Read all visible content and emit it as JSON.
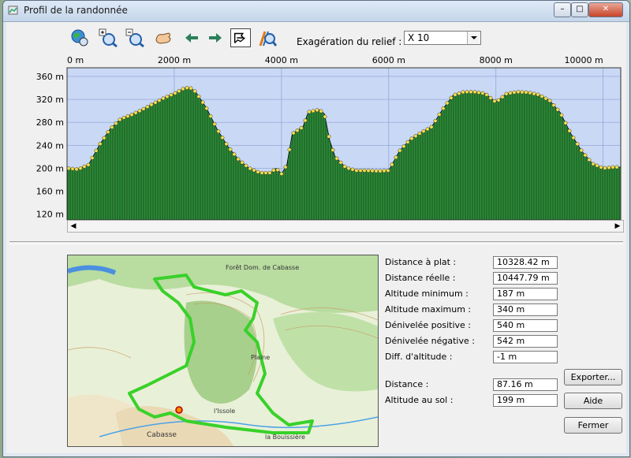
{
  "window": {
    "title": "Profil de la randonnée"
  },
  "toolbar": {
    "relief_label": "Exagération du relief :",
    "relief_value": "X 10"
  },
  "chart_data": {
    "type": "area",
    "x_ticks": [
      "0 m",
      "2000 m",
      "4000 m",
      "6000 m",
      "8000 m",
      "10000 m"
    ],
    "y_ticks": [
      "360 m",
      "320 m",
      "280 m",
      "240 m",
      "200 m",
      "160 m",
      "120 m"
    ],
    "xlim": [
      0,
      10328
    ],
    "ylim": [
      110,
      375
    ],
    "grid": true,
    "x": [
      0,
      200,
      400,
      600,
      800,
      1000,
      1200,
      1400,
      1600,
      1800,
      2000,
      2200,
      2300,
      2400,
      2600,
      2800,
      3000,
      3200,
      3400,
      3600,
      3800,
      3900,
      4000,
      4100,
      4200,
      4400,
      4500,
      4700,
      4800,
      4900,
      5000,
      5200,
      5400,
      5600,
      5800,
      6000,
      6200,
      6400,
      6600,
      6800,
      7000,
      7200,
      7400,
      7600,
      7800,
      8000,
      8200,
      8400,
      8600,
      8800,
      9000,
      9200,
      9400,
      9600,
      9800,
      10000,
      10200,
      10328
    ],
    "y": [
      200,
      198,
      206,
      240,
      268,
      286,
      293,
      302,
      312,
      322,
      330,
      340,
      340,
      333,
      305,
      268,
      238,
      215,
      200,
      192,
      192,
      200,
      190,
      206,
      260,
      272,
      298,
      302,
      295,
      248,
      220,
      201,
      196,
      196,
      195,
      196,
      230,
      250,
      262,
      272,
      302,
      327,
      333,
      333,
      330,
      315,
      330,
      333,
      332,
      328,
      318,
      297,
      260,
      230,
      208,
      200,
      202,
      202
    ],
    "color_fill": "#2e8b3a",
    "color_sky": "#c9d8f5",
    "color_points": "#f4df4c"
  },
  "stats": [
    {
      "label": "Distance à plat :",
      "value": "10328.42 m"
    },
    {
      "label": "Distance réelle :",
      "value": "10447.79 m"
    },
    {
      "label": "Altitude minimum :",
      "value": "187 m"
    },
    {
      "label": "Altitude maximum :",
      "value": "340 m"
    },
    {
      "label": "Dénivelée positive :",
      "value": "540 m"
    },
    {
      "label": "Dénivelée négative :",
      "value": "542 m"
    },
    {
      "label": "Diff. d'altitude :",
      "value": "-1 m"
    },
    {
      "label": "Distance :",
      "value": "87.16 m"
    },
    {
      "label": "Altitude au sol :",
      "value": "199 m"
    }
  ],
  "buttons": {
    "export": "Exporter...",
    "help": "Aide",
    "close": "Fermer"
  },
  "map": {
    "labels": [
      "Forêt Dom. de Cabasse",
      "Plaine",
      "Cabasse",
      "l'Issole",
      "la Bouissière"
    ],
    "track_color": "#39d12a"
  }
}
